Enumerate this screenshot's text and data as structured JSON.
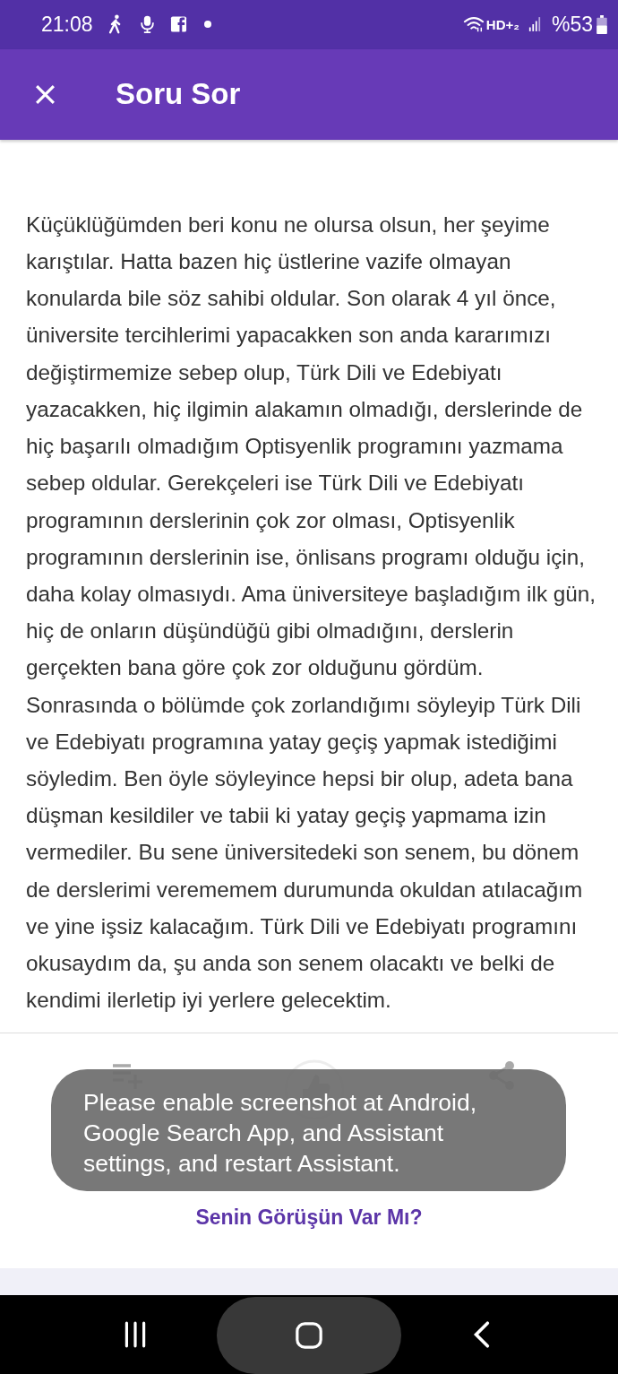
{
  "status_bar": {
    "time": "21:08",
    "network": "HD+₂",
    "battery": "%53"
  },
  "app_bar": {
    "title": "Soru Sor"
  },
  "question": {
    "text": "Küçüklüğümden beri konu ne olursa olsun, her şeyime karıştılar. Hatta bazen hiç üstlerine vazife olmayan konularda bile söz sahibi oldular. Son olarak 4 yıl önce, üniversite tercihlerimi yapacakken son anda kararımızı değiştirmemize sebep olup, Türk Dili ve Edebiyatı yazacakken, hiç ilgimin alakamın olmadığı, derslerinde de hiç başarılı olmadığım Optisyenlik programını yazmama sebep oldular. Gerekçeleri ise Türk Dili ve Edebiyatı programının derslerinin çok zor olması, Optisyenlik programının derslerinin ise, önlisans programı olduğu için, daha kolay olmasıydı. Ama üniversiteye başladığım ilk gün, hiç de onların düşündüğü gibi olmadığını, derslerin gerçekten bana göre çok zor olduğunu gördüm. Sonrasında o bölümde çok zorlandığımı söyleyip Türk Dili ve Edebiyatı programına yatay geçiş yapmak istediğimi söyledim. Ben öyle söyleyince hepsi bir olup, adeta bana düşman kesildiler ve tabii ki yatay geçiş yapmama izin vermediler. Bu sene üniversitedeki son senem, bu dönem de derslerimi verememem durumunda okuldan atılacağım ve yine işsiz kalacağım. Türk Dili ve Edebiyatı programını okusaydım da, şu anda son senem olacaktı ve belki de kendimi ilerletip iyi yerlere gelecektim."
  },
  "actions": [
    {
      "kind": "follow"
    },
    {
      "kind": "like"
    },
    {
      "kind": "share"
    }
  ],
  "toast": {
    "text": "Please enable screenshot at Android, Google Search App, and Assistant settings, and restart Assistant."
  },
  "answer_link": "Senin Görüşün Var Mı?"
}
